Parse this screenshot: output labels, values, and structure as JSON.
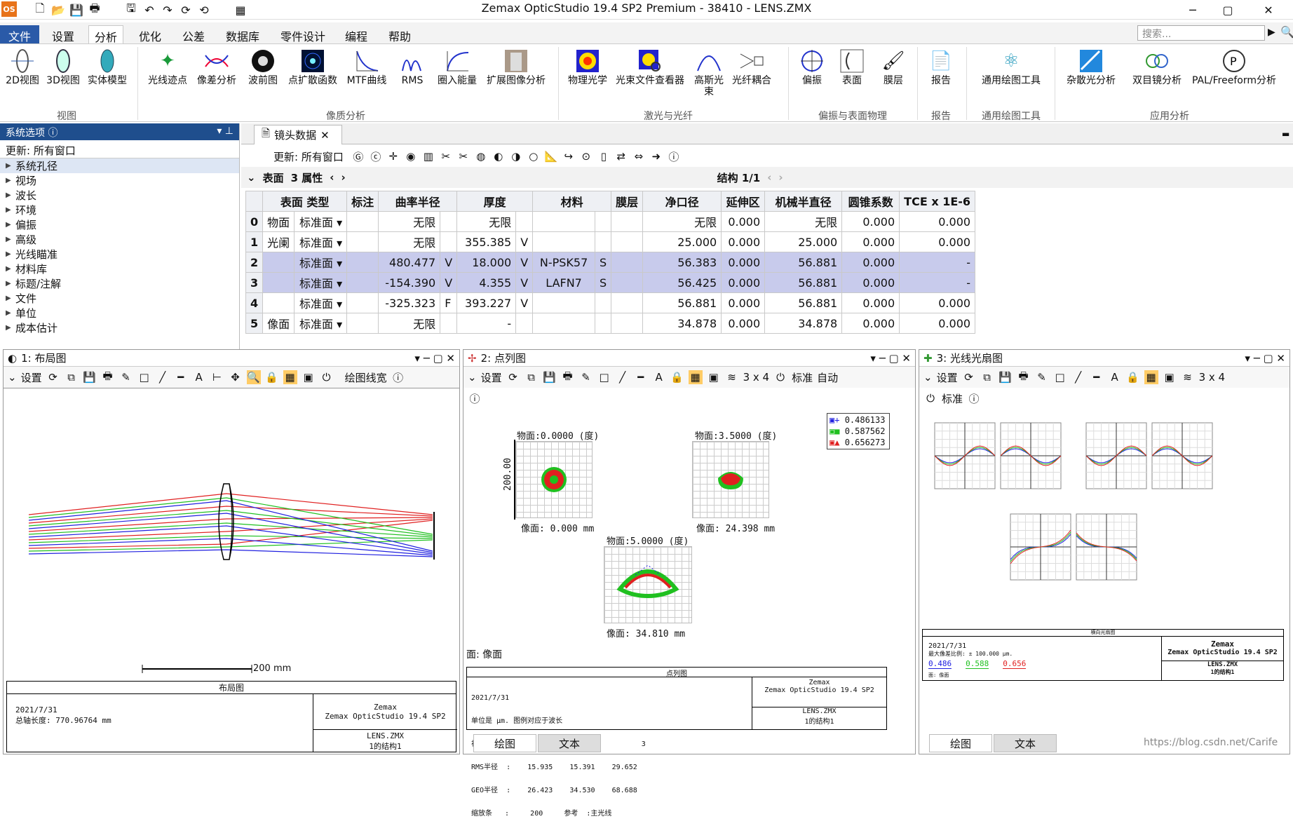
{
  "app": {
    "title": "Zemax OpticStudio 19.4 SP2   Premium - 38410 - LENS.ZMX",
    "logo": "OS",
    "search_placeholder": "搜索..."
  },
  "menu": [
    "文件",
    "设置",
    "分析",
    "优化",
    "公差",
    "数据库",
    "零件设计",
    "编程",
    "帮助"
  ],
  "ribbon": {
    "buttons": [
      "2D视图",
      "3D视图",
      "实体模型",
      "光线迹点",
      "像差分析",
      "波前图",
      "点扩散函数",
      "MTF曲线",
      "RMS",
      "圈入能量",
      "扩展图像分析",
      "物理光学",
      "光束文件查看器",
      "高斯光束",
      "光纤耦合",
      "偏振",
      "表面",
      "膜层",
      "报告",
      "通用绘图工具",
      "杂散光分析",
      "双目镜分析",
      "PAL/Freeform分析"
    ],
    "groups": [
      "视图",
      "像质分析",
      "激光与光纤",
      "偏振与表面物理",
      "报告",
      "通用绘图工具",
      "应用分析"
    ]
  },
  "sysopt": {
    "title": "系统选项",
    "update": "更新: 所有窗口",
    "items": [
      "系统孔径",
      "视场",
      "波长",
      "环境",
      "偏振",
      "高级",
      "光线瞄准",
      "材料库",
      "标题/注解",
      "文件",
      "单位",
      "成本估计"
    ]
  },
  "lde": {
    "tab": "镜头数据",
    "update": "更新: 所有窗口",
    "surface_label": "表面",
    "props_label": "3 属性",
    "config": "结构 1/1",
    "headers": [
      "表面 类型",
      "标注",
      "曲率半径",
      "",
      "厚度",
      "",
      "材料",
      "",
      "膜层",
      "净口径",
      "延伸区",
      "机械半直径",
      "圆锥系数",
      "TCE x 1E-6"
    ],
    "rows": [
      [
        "0",
        "物面",
        "标准面",
        "",
        "无限",
        "",
        "无限",
        "",
        "",
        "",
        "",
        "无限",
        "0.000",
        "无限",
        "0.000",
        "0.000"
      ],
      [
        "1",
        "光阑",
        "标准面",
        "",
        "无限",
        "",
        "355.385",
        "V",
        "",
        "",
        "",
        "25.000",
        "0.000",
        "25.000",
        "0.000",
        "0.000"
      ],
      [
        "2",
        "",
        "标准面",
        "",
        "480.477",
        "V",
        "18.000",
        "V",
        "N-PSK57",
        "S",
        "",
        "56.383",
        "0.000",
        "56.881",
        "0.000",
        "-"
      ],
      [
        "3",
        "",
        "标准面",
        "",
        "-154.390",
        "V",
        "4.355",
        "V",
        "LAFN7",
        "S",
        "",
        "56.425",
        "0.000",
        "56.881",
        "0.000",
        "-"
      ],
      [
        "4",
        "",
        "标准面",
        "",
        "-325.323",
        "F",
        "393.227",
        "V",
        "",
        "",
        "",
        "56.881",
        "0.000",
        "56.881",
        "0.000",
        "0.000"
      ],
      [
        "5",
        "像面",
        "标准面",
        "",
        "无限",
        "",
        "-",
        "",
        "",
        "",
        "",
        "34.878",
        "0.000",
        "34.878",
        "0.000",
        "0.000"
      ]
    ]
  },
  "win1": {
    "title": "1: 布局图",
    "settings": "设置",
    "mode": "绘图线宽",
    "scale": "200 mm",
    "caption": "布局图",
    "date": "2021/7/31",
    "total_len": "总轴长度:   770.96764 mm",
    "company": "Zemax",
    "product": "Zemax OpticStudio 19.4 SP2",
    "file": "LENS.ZMX",
    "config": "1的结构1"
  },
  "win2": {
    "title": "2: 点列图",
    "settings": "设置",
    "grid": "3 x 4",
    "mode1": "标准",
    "mode2": "自动",
    "fields": [
      {
        "obj": "物面:0.0000 (度)",
        "img": "像面: 0.000 mm"
      },
      {
        "obj": "物面:3.5000 (度)",
        "img": "像面: 24.398 mm"
      },
      {
        "obj": "物面:5.0000 (度)",
        "img": "像面: 34.810 mm"
      }
    ],
    "axis_label": "200.00",
    "wavelengths": [
      "0.486133",
      "0.587562",
      "0.656273"
    ],
    "surface": "面: 像面",
    "caption": "点列图",
    "footer_lines": [
      "2021/7/31",
      "单位是 µm. 图例对应于波长",
      "视场     :         1          2          3",
      "RMS半径  :    15.935    15.391    29.652",
      "GEO半径  :    26.423    34.530    68.688",
      "缩放条   :     200     参考  :主光线"
    ],
    "company": "Zemax",
    "product": "Zemax OpticStudio 19.4 SP2",
    "file": "LENS.ZMX",
    "config": "1的结构1",
    "tabs": [
      "绘图",
      "文本"
    ]
  },
  "win3": {
    "title": "3: 光线光扇图",
    "settings": "设置",
    "grid": "3 x 4",
    "mode1": "标准",
    "caption": "横向光扇图",
    "date": "2021/7/31",
    "scale_line": "最大像差比例: ± 100.000 µm.",
    "wl": [
      "0.486",
      "0.588",
      "0.656"
    ],
    "surf": "面: 像面",
    "company": "Zemax",
    "product": "Zemax OpticStudio 19.4 SP2",
    "file": "LENS.ZMX",
    "config": "1的结构1",
    "tabs": [
      "绘图",
      "文本"
    ],
    "watermark": "https://blog.csdn.net/Carife"
  },
  "colors": {
    "blue": "#1f4e8d",
    "red": "#e02020",
    "green": "#20c020",
    "navy": "#2020e0"
  }
}
